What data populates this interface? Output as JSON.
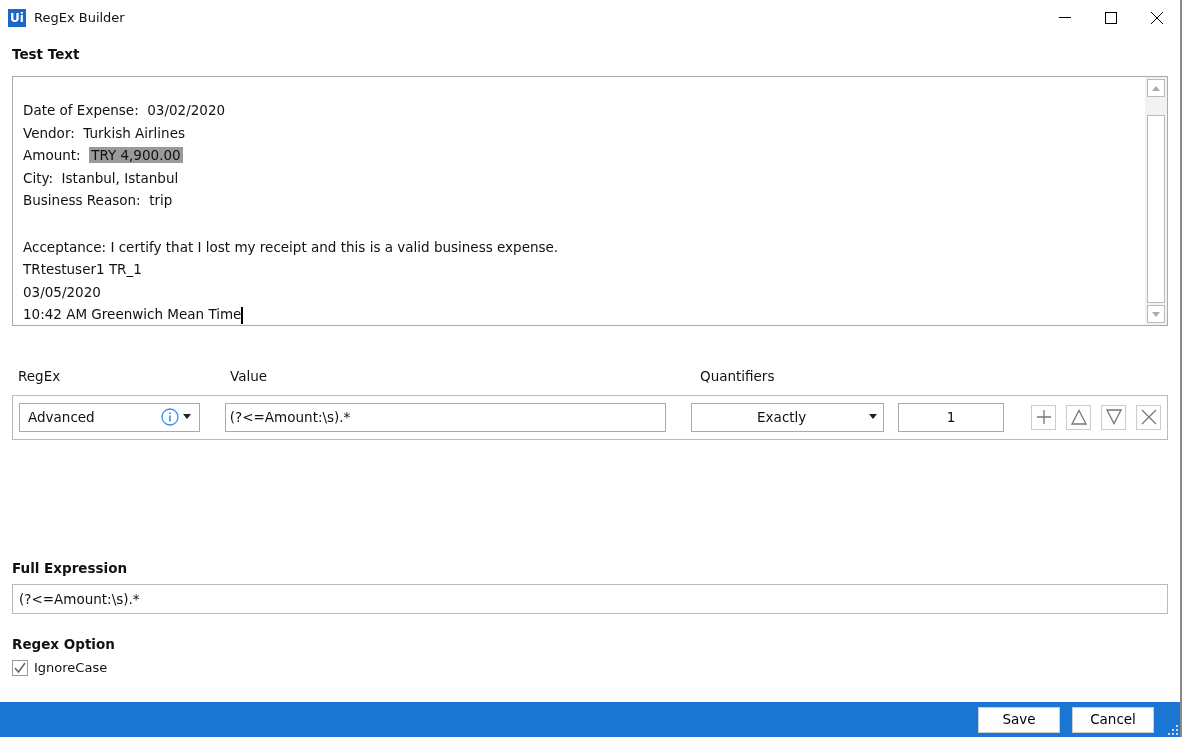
{
  "window": {
    "title": "RegEx Builder",
    "logo": "Ui"
  },
  "test_text": {
    "label": "Test Text",
    "paragraphs": [
      [
        {
          "text": "Date of Expense:  03/02/2020"
        },
        {
          "text": "Vendor:  Turkish Airlines"
        },
        {
          "text": "Amount:  ",
          "selection": "TRY 4,900.00"
        },
        {
          "text": "City:  Istanbul, Istanbul"
        },
        {
          "text": "Business Reason:  trip"
        }
      ],
      [
        {
          "text": "Acceptance: I certify that I lost my receipt and this is a valid business expense."
        },
        {
          "text": "TRtestuser1 TR_1"
        },
        {
          "text": "03/05/2020"
        },
        {
          "text": "10:42 AM Greenwich Mean Time"
        }
      ]
    ]
  },
  "builder": {
    "columns": [
      "RegEx",
      "Value",
      "Quantifiers"
    ],
    "rows": [
      {
        "regex": "Advanced",
        "value": "(?<=Amount:\\s).*",
        "quantifier": "Exactly",
        "count": "1"
      }
    ]
  },
  "full_expression": {
    "label": "Full Expression",
    "value": "(?<=Amount:\\s).*"
  },
  "regex_option": {
    "label": "Regex Option",
    "options": [
      {
        "label": "IgnoreCase",
        "checked": true
      }
    ]
  },
  "buttons": [
    "Save",
    "Cancel"
  ]
}
